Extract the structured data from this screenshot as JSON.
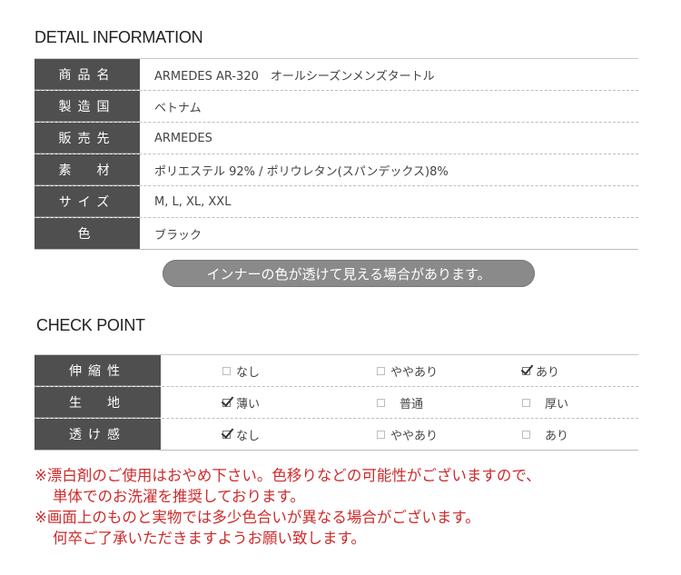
{
  "detail": {
    "title": "DETAIL INFORMATION",
    "rows": [
      {
        "label": "商品名",
        "value": "ARMEDES AR-320　オールシーズンメンズタートル"
      },
      {
        "label": "製造国",
        "value": "ベトナム"
      },
      {
        "label": "販売先",
        "value": "ARMEDES"
      },
      {
        "label": "素　材",
        "value": "ポリエステル 92%  / ポリウレタン(スパンデックス)8%"
      },
      {
        "label": "サイズ",
        "value": "M, L, XL, XXL"
      },
      {
        "label": "色",
        "value": "ブラック"
      }
    ]
  },
  "notice": "インナーの色が透けて見える場合があります。",
  "check": {
    "title": "CHECK POINT",
    "rows": [
      {
        "label": "伸縮性",
        "options": [
          {
            "label": "なし",
            "checked": false
          },
          {
            "label": "ややあり",
            "checked": false
          },
          {
            "label": "あり",
            "checked": true
          }
        ]
      },
      {
        "label": "生　地",
        "options": [
          {
            "label": "薄い",
            "checked": true
          },
          {
            "label": "普通",
            "checked": false
          },
          {
            "label": "厚い",
            "checked": false
          }
        ]
      },
      {
        "label": "透け感",
        "options": [
          {
            "label": "なし",
            "checked": true
          },
          {
            "label": "ややあり",
            "checked": false
          },
          {
            "label": "あり",
            "checked": false
          }
        ]
      }
    ]
  },
  "notes": [
    "※漂白剤のご使用はおやめ下さい。色移りなどの可能性がございますので、",
    "単体でのお洗濯を推奨しております。",
    "※画面上のものと実物では多少色合いが異なる場合がございます。",
    "何卒ご了承いただきますようお願い致します。"
  ],
  "colors": {
    "label_bg": "#4f4f4f",
    "pill_bg": "#8a8a8a",
    "note_text": "#cc2b2b"
  }
}
